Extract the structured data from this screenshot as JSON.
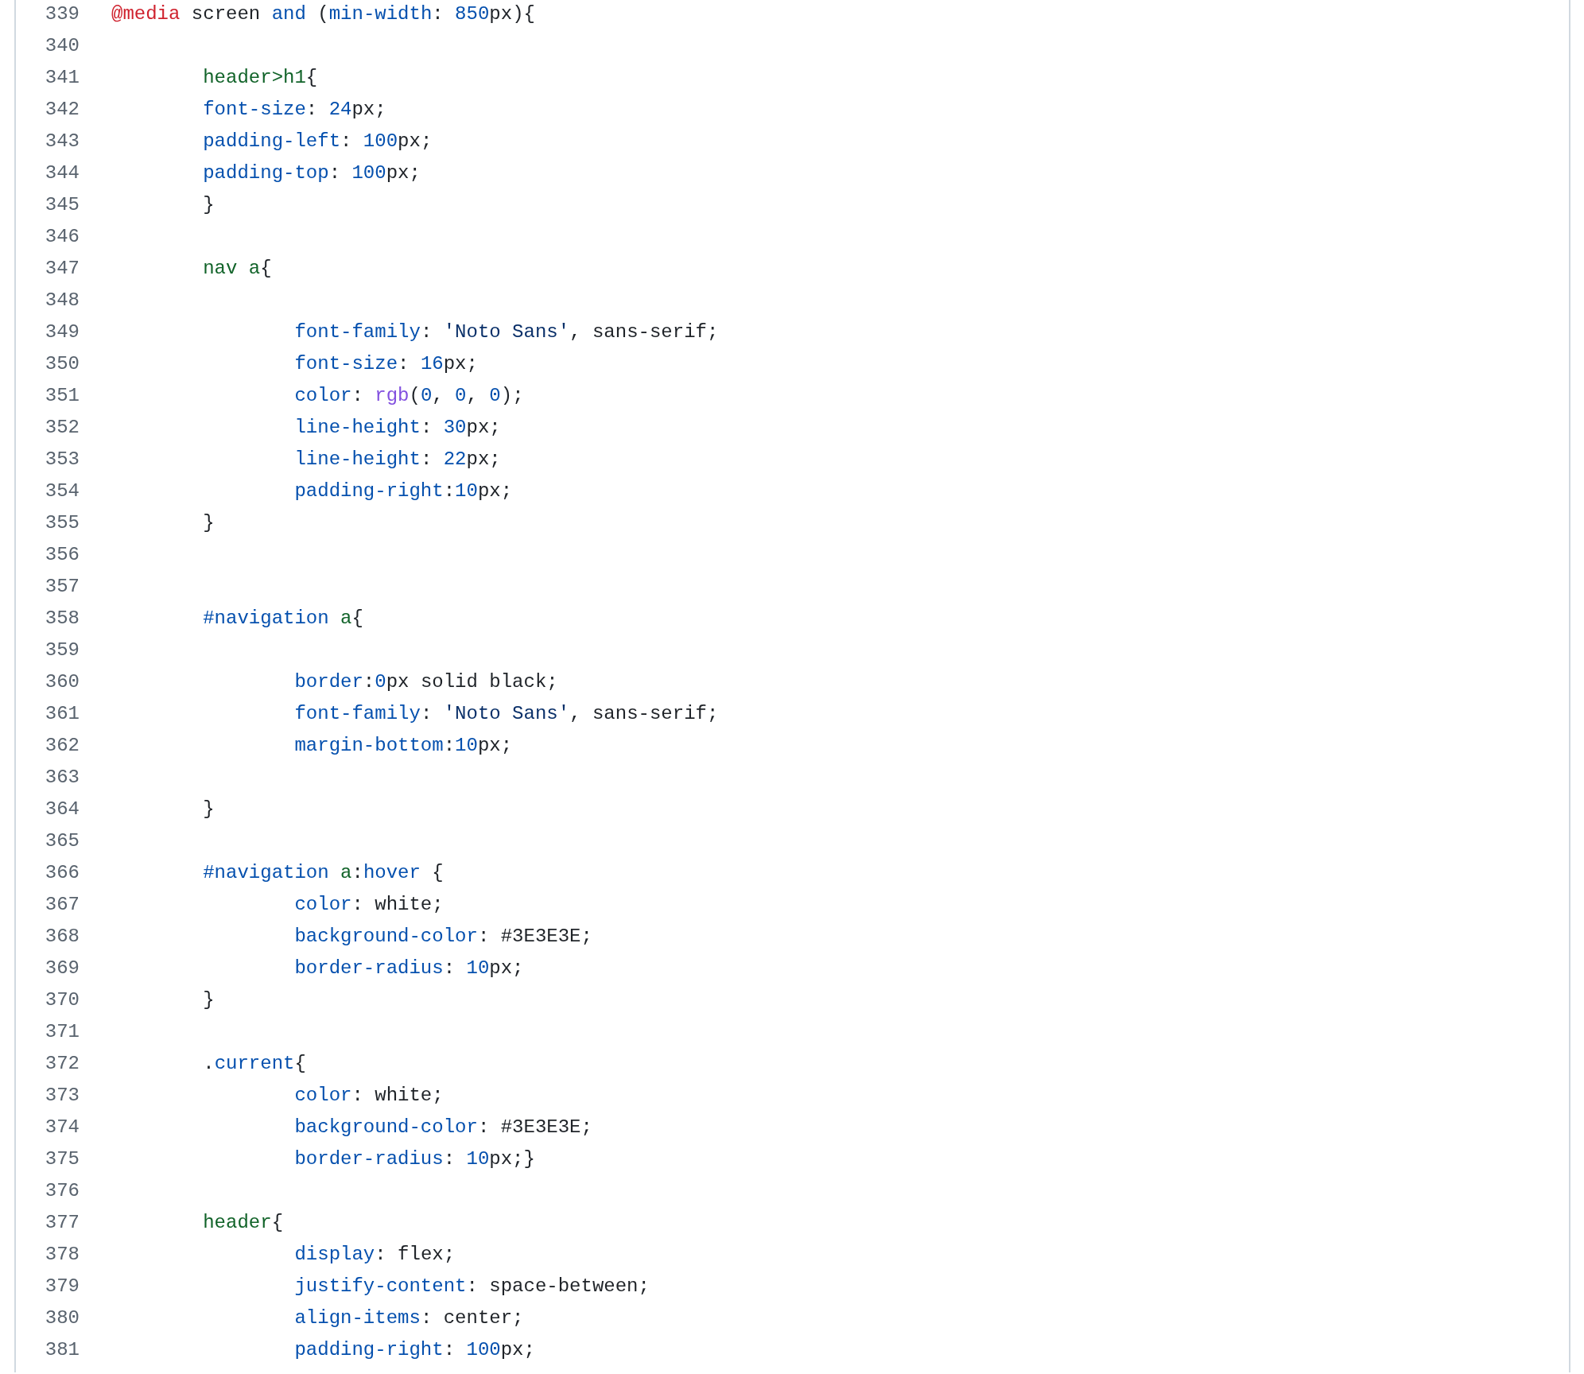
{
  "code_view": {
    "lines": [
      {
        "number": "339",
        "tokens": [
          {
            "text": "@media",
            "kind": "keyword"
          },
          {
            "text": " screen ",
            "kind": "plain"
          },
          {
            "text": "and",
            "kind": "property"
          },
          {
            "text": " (",
            "kind": "plain"
          },
          {
            "text": "min-width",
            "kind": "property"
          },
          {
            "text": ": ",
            "kind": "plain"
          },
          {
            "text": "850",
            "kind": "number"
          },
          {
            "text": "px){",
            "kind": "plain"
          }
        ]
      },
      {
        "number": "340"
      },
      {
        "number": "341",
        "tokens": [
          {
            "text": "\theader>h1",
            "kind": "selector"
          },
          {
            "text": "{",
            "kind": "plain"
          }
        ]
      },
      {
        "number": "342",
        "tokens": [
          {
            "text": "\tfont-size",
            "kind": "property"
          },
          {
            "text": ": ",
            "kind": "plain"
          },
          {
            "text": "24",
            "kind": "number"
          },
          {
            "text": "px;",
            "kind": "plain"
          }
        ]
      },
      {
        "number": "343",
        "tokens": [
          {
            "text": "\tpadding-left",
            "kind": "property"
          },
          {
            "text": ": ",
            "kind": "plain"
          },
          {
            "text": "100",
            "kind": "number"
          },
          {
            "text": "px;",
            "kind": "plain"
          }
        ]
      },
      {
        "number": "344",
        "tokens": [
          {
            "text": "\tpadding-top",
            "kind": "property"
          },
          {
            "text": ": ",
            "kind": "plain"
          },
          {
            "text": "100",
            "kind": "number"
          },
          {
            "text": "px;",
            "kind": "plain"
          }
        ]
      },
      {
        "number": "345",
        "tokens": [
          {
            "text": "\t}",
            "kind": "plain"
          }
        ]
      },
      {
        "number": "346"
      },
      {
        "number": "347",
        "tokens": [
          {
            "text": "\tnav a",
            "kind": "selector"
          },
          {
            "text": "{",
            "kind": "plain"
          }
        ]
      },
      {
        "number": "348"
      },
      {
        "number": "349",
        "tokens": [
          {
            "text": "\t\tfont-family",
            "kind": "property"
          },
          {
            "text": ": ",
            "kind": "plain"
          },
          {
            "text": "'Noto Sans'",
            "kind": "string"
          },
          {
            "text": ", sans-serif;",
            "kind": "plain"
          }
        ]
      },
      {
        "number": "350",
        "tokens": [
          {
            "text": "\t\tfont-size",
            "kind": "property"
          },
          {
            "text": ": ",
            "kind": "plain"
          },
          {
            "text": "16",
            "kind": "number"
          },
          {
            "text": "px;",
            "kind": "plain"
          }
        ]
      },
      {
        "number": "351",
        "tokens": [
          {
            "text": "\t\tcolor",
            "kind": "property"
          },
          {
            "text": ": ",
            "kind": "plain"
          },
          {
            "text": "rgb",
            "kind": "function"
          },
          {
            "text": "(",
            "kind": "plain"
          },
          {
            "text": "0",
            "kind": "number"
          },
          {
            "text": ", ",
            "kind": "plain"
          },
          {
            "text": "0",
            "kind": "number"
          },
          {
            "text": ", ",
            "kind": "plain"
          },
          {
            "text": "0",
            "kind": "number"
          },
          {
            "text": ");",
            "kind": "plain"
          }
        ]
      },
      {
        "number": "352",
        "tokens": [
          {
            "text": "\t\tline-height",
            "kind": "property"
          },
          {
            "text": ": ",
            "kind": "plain"
          },
          {
            "text": "30",
            "kind": "number"
          },
          {
            "text": "px;",
            "kind": "plain"
          }
        ]
      },
      {
        "number": "353",
        "tokens": [
          {
            "text": "\t\tline-height",
            "kind": "property"
          },
          {
            "text": ": ",
            "kind": "plain"
          },
          {
            "text": "22",
            "kind": "number"
          },
          {
            "text": "px;",
            "kind": "plain"
          }
        ]
      },
      {
        "number": "354",
        "tokens": [
          {
            "text": "\t\tpadding-right",
            "kind": "property"
          },
          {
            "text": ":",
            "kind": "plain"
          },
          {
            "text": "10",
            "kind": "number"
          },
          {
            "text": "px;",
            "kind": "plain"
          }
        ]
      },
      {
        "number": "355",
        "tokens": [
          {
            "text": "\t}",
            "kind": "plain"
          }
        ]
      },
      {
        "number": "356"
      },
      {
        "number": "357"
      },
      {
        "number": "358",
        "tokens": [
          {
            "text": "\t#navigation",
            "kind": "property"
          },
          {
            "text": " a",
            "kind": "selector"
          },
          {
            "text": "{",
            "kind": "plain"
          }
        ]
      },
      {
        "number": "359"
      },
      {
        "number": "360",
        "tokens": [
          {
            "text": "\t\tborder",
            "kind": "property"
          },
          {
            "text": ":",
            "kind": "plain"
          },
          {
            "text": "0",
            "kind": "number"
          },
          {
            "text": "px solid black;",
            "kind": "plain"
          }
        ]
      },
      {
        "number": "361",
        "tokens": [
          {
            "text": "\t\tfont-family",
            "kind": "property"
          },
          {
            "text": ": ",
            "kind": "plain"
          },
          {
            "text": "'Noto Sans'",
            "kind": "string"
          },
          {
            "text": ", sans-serif;",
            "kind": "plain"
          }
        ]
      },
      {
        "number": "362",
        "tokens": [
          {
            "text": "\t\tmargin-bottom",
            "kind": "property"
          },
          {
            "text": ":",
            "kind": "plain"
          },
          {
            "text": "10",
            "kind": "number"
          },
          {
            "text": "px;",
            "kind": "plain"
          }
        ]
      },
      {
        "number": "363"
      },
      {
        "number": "364",
        "tokens": [
          {
            "text": "\t}",
            "kind": "plain"
          }
        ]
      },
      {
        "number": "365"
      },
      {
        "number": "366",
        "tokens": [
          {
            "text": "\t#navigation",
            "kind": "property"
          },
          {
            "text": " a",
            "kind": "selector"
          },
          {
            "text": ":",
            "kind": "plain"
          },
          {
            "text": "hover",
            "kind": "property"
          },
          {
            "text": " {",
            "kind": "plain"
          }
        ]
      },
      {
        "number": "367",
        "tokens": [
          {
            "text": "\t\tcolor",
            "kind": "property"
          },
          {
            "text": ": white;",
            "kind": "plain"
          }
        ]
      },
      {
        "number": "368",
        "tokens": [
          {
            "text": "\t\tbackground-color",
            "kind": "property"
          },
          {
            "text": ": #3E3E3E;",
            "kind": "plain"
          }
        ]
      },
      {
        "number": "369",
        "tokens": [
          {
            "text": "\t\tborder-radius",
            "kind": "property"
          },
          {
            "text": ": ",
            "kind": "plain"
          },
          {
            "text": "10",
            "kind": "number"
          },
          {
            "text": "px;",
            "kind": "plain"
          }
        ]
      },
      {
        "number": "370",
        "tokens": [
          {
            "text": "\t}",
            "kind": "plain"
          }
        ]
      },
      {
        "number": "371"
      },
      {
        "number": "372",
        "tokens": [
          {
            "text": "\t.",
            "kind": "plain"
          },
          {
            "text": "current",
            "kind": "property"
          },
          {
            "text": "{",
            "kind": "plain"
          }
        ]
      },
      {
        "number": "373",
        "tokens": [
          {
            "text": "\t\tcolor",
            "kind": "property"
          },
          {
            "text": ": white;",
            "kind": "plain"
          }
        ]
      },
      {
        "number": "374",
        "tokens": [
          {
            "text": "\t\tbackground-color",
            "kind": "property"
          },
          {
            "text": ": #3E3E3E;",
            "kind": "plain"
          }
        ]
      },
      {
        "number": "375",
        "tokens": [
          {
            "text": "\t\tborder-radius",
            "kind": "property"
          },
          {
            "text": ": ",
            "kind": "plain"
          },
          {
            "text": "10",
            "kind": "number"
          },
          {
            "text": "px;}",
            "kind": "plain"
          }
        ]
      },
      {
        "number": "376"
      },
      {
        "number": "377",
        "tokens": [
          {
            "text": "\theader",
            "kind": "selector"
          },
          {
            "text": "{",
            "kind": "plain"
          }
        ]
      },
      {
        "number": "378",
        "tokens": [
          {
            "text": "\t\tdisplay",
            "kind": "property"
          },
          {
            "text": ": flex;",
            "kind": "plain"
          }
        ]
      },
      {
        "number": "379",
        "tokens": [
          {
            "text": "\t\tjustify-content",
            "kind": "property"
          },
          {
            "text": ": space-between;",
            "kind": "plain"
          }
        ]
      },
      {
        "number": "380",
        "tokens": [
          {
            "text": "\t\talign-items",
            "kind": "property"
          },
          {
            "text": ": center;",
            "kind": "plain"
          }
        ]
      },
      {
        "number": "381",
        "tokens": [
          {
            "text": "\t\tpadding-right",
            "kind": "property"
          },
          {
            "text": ": ",
            "kind": "plain"
          },
          {
            "text": "100",
            "kind": "number"
          },
          {
            "text": "px;",
            "kind": "plain"
          }
        ]
      }
    ]
  }
}
